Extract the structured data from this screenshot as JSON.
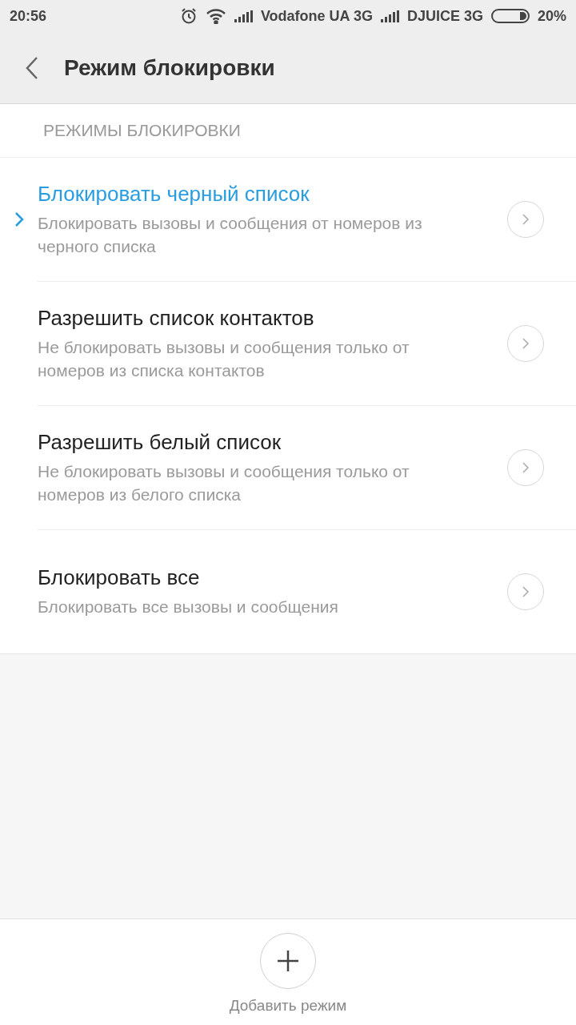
{
  "status_bar": {
    "time": "20:56",
    "carrier_1": "Vodafone UA 3G",
    "carrier_2": "DJUICE 3G",
    "battery": "20%"
  },
  "header": {
    "title": "Режим блокировки"
  },
  "section": {
    "title": "РЕЖИМЫ БЛОКИРОВКИ"
  },
  "modes": [
    {
      "title": "Блокировать черный список",
      "subtitle": "Блокировать вызовы и сообщения от номеров из черного списка",
      "selected": true
    },
    {
      "title": "Разрешить список контактов",
      "subtitle": "Не блокировать вызовы и сообщения только от номеров из списка контактов",
      "selected": false
    },
    {
      "title": "Разрешить белый список",
      "subtitle": "Не блокировать вызовы и сообщения только от номеров из белого списка",
      "selected": false
    },
    {
      "title": "Блокировать все",
      "subtitle": "Блокировать все вызовы и сообщения",
      "selected": false
    }
  ],
  "add_button": {
    "label": "Добавить режим"
  }
}
